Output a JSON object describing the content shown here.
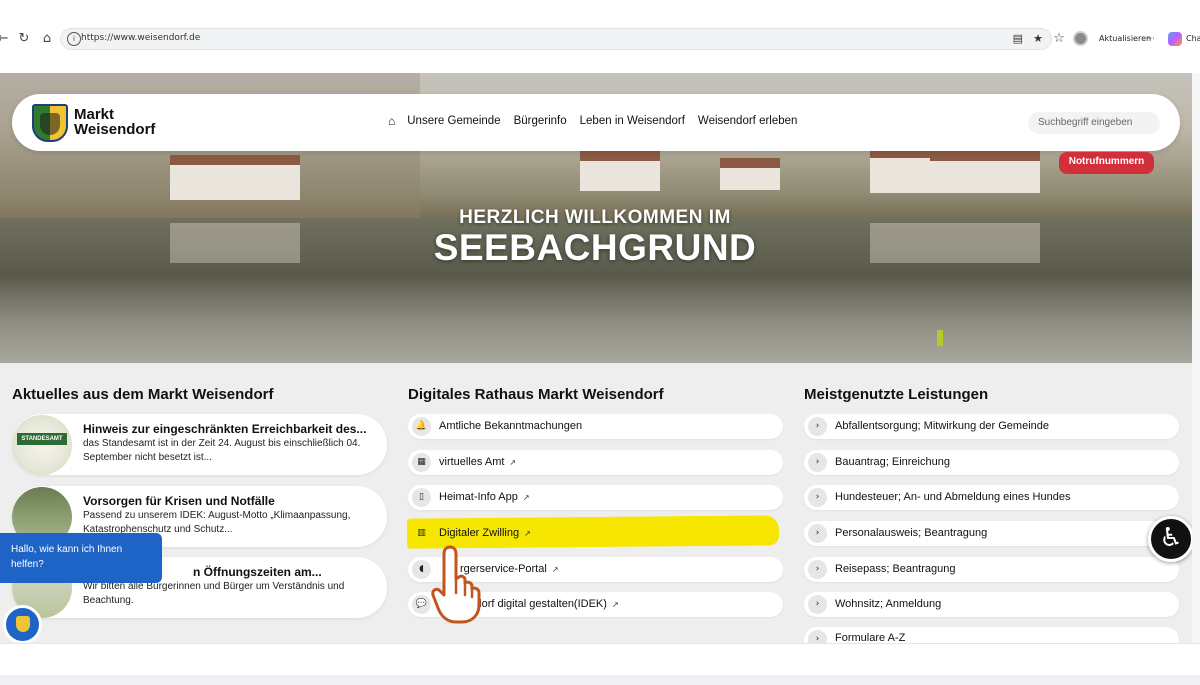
{
  "browser": {
    "url": "https://www.weisendorf.de",
    "update_label": "Aktualisieren",
    "more_label": "···",
    "chat_label": "Cha",
    "icons": [
      "back-icon",
      "reload-icon",
      "home-icon",
      "lock-icon",
      "reader-icon",
      "star-icon",
      "favorites-icon",
      "avatar",
      "copilot-icon"
    ]
  },
  "header": {
    "logo_line1": "Markt",
    "logo_line2": "Weisendorf",
    "nav": [
      "Unsere Gemeinde",
      "Bürgerinfo",
      "Leben in Weisendorf",
      "Weisendorf erleben"
    ],
    "search_placeholder": "Suchbegriff eingeben",
    "emergency": "Notrufnummern"
  },
  "hero": {
    "line1": "HERZLICH WILLKOMMEN IM",
    "line2": "SEEBACHGRUND"
  },
  "news": {
    "title": "Aktuelles aus dem Markt Weisendorf",
    "items": [
      {
        "title": "Hinweis zur eingeschränkten Erreichbarkeit des...",
        "text": "das Standesamt ist in der Zeit 24. August bis einschließlich 04. September nicht besetzt ist...",
        "thumb_label": "STANDESAMT"
      },
      {
        "title": "Vorsorgen für Krisen und Notfälle",
        "text": "Passend zu unserem IDEK: August-Motto „Klimaanpassung, Katastrophenschutz und Schutz...",
        "thumb_label": ""
      },
      {
        "title": "n Öffnungszeiten am...",
        "text": "Wir bitten alle Bürgerinnen und Bürger um Verständnis und Beachtung.",
        "thumb_label": ""
      }
    ]
  },
  "rathaus": {
    "title": "Digitales Rathaus Markt Weisendorf",
    "items": [
      {
        "label": "Amtliche Bekanntmachungen",
        "icon": "bell-icon",
        "external": false
      },
      {
        "label": "virtuelles Amt",
        "icon": "building-icon",
        "external": true
      },
      {
        "label": "Heimat-Info App",
        "icon": "phone-icon",
        "external": true
      },
      {
        "label": "Digitaler Zwilling",
        "icon": "map-icon",
        "external": true
      },
      {
        "label": "rgerservice-Portal",
        "icon": "mouse-icon",
        "external": true
      },
      {
        "label": "Weisendorf digital gestalten(IDEK)",
        "icon": "chat-icon",
        "external": true
      }
    ]
  },
  "services": {
    "title": "Meistgenutzte Leistungen",
    "items": [
      "Abfallentsorgung; Mitwirkung der Gemeinde",
      "Bauantrag; Einreichung",
      "Hundesteuer; An- und Abmeldung eines Hundes",
      "Personalausweis; Beantragung",
      "Reisepass; Beantragung",
      "Wohnsitz; Anmeldung",
      "Formulare A-Z"
    ]
  },
  "chat": {
    "greeting": "Hallo, wie kann ich Ihnen helfen?"
  },
  "colors": {
    "emergency": "#d22f3a",
    "highlight": "#f6e600",
    "chat": "#1e63c6"
  }
}
